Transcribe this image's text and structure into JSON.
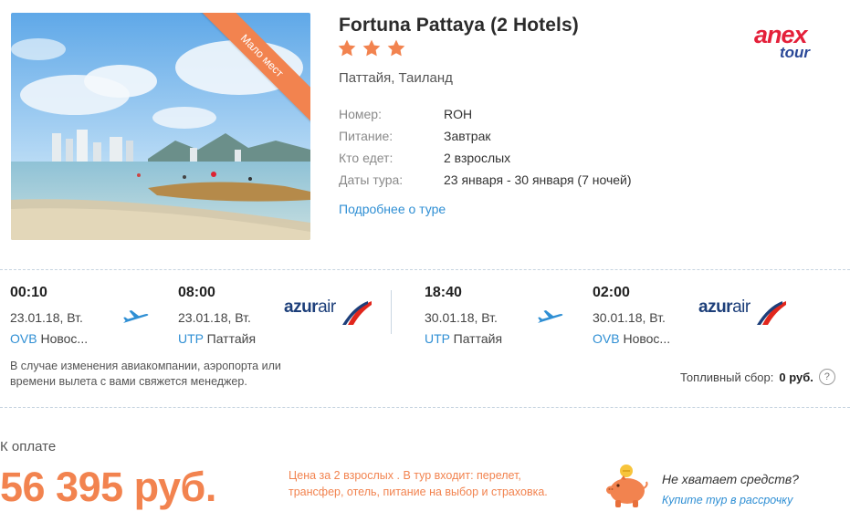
{
  "hotel": {
    "badge": "Мало мест",
    "name": "Fortuna Pattaya (2 Hotels)",
    "stars": 3,
    "location": "Паттайя, Таиланд",
    "details": [
      {
        "label": "Номер:",
        "value": "ROH"
      },
      {
        "label": "Питание:",
        "value": "Завтрак"
      },
      {
        "label": "Кто едет:",
        "value": "2 взрослых"
      },
      {
        "label": "Даты тура:",
        "value": "23 января - 30 января (7 ночей)"
      }
    ],
    "more_link": "Подробнее о туре"
  },
  "operator": {
    "logo_line1": "anex",
    "logo_line2": "tour"
  },
  "flights": {
    "outbound": {
      "dep": {
        "time": "00:10",
        "date": "23.01.18, Вт.",
        "code": "OVB",
        "city": "Новос..."
      },
      "arr": {
        "time": "08:00",
        "date": "23.01.18, Вт.",
        "code": "UTP",
        "city": "Паттайя"
      },
      "airline_a": "azur",
      "airline_b": "air"
    },
    "inbound": {
      "dep": {
        "time": "18:40",
        "date": "30.01.18, Вт.",
        "code": "UTP",
        "city": "Паттайя"
      },
      "arr": {
        "time": "02:00",
        "date": "30.01.18, Вт.",
        "code": "OVB",
        "city": "Новос..."
      },
      "airline_a": "azur",
      "airline_b": "air"
    },
    "note": "В случае изменения авиакомпании, аэропорта или времени вылета с вами свяжется менеджер.",
    "fuel_label": "Топливный сбор:",
    "fuel_value": "0 руб.",
    "help_icon": "?"
  },
  "payment": {
    "label": "К оплате",
    "price": "56 395 руб.",
    "price_note": "Цена за 2 взрослых . В тур входит: перелет, трансфер, отель, питание на выбор и страховка.",
    "nofunds": "Не хватает средств?",
    "credit_link": "Купите тур в рассрочку"
  },
  "colors": {
    "accent": "#f2834f",
    "link": "#2f8fd4",
    "star": "#f2834f"
  }
}
